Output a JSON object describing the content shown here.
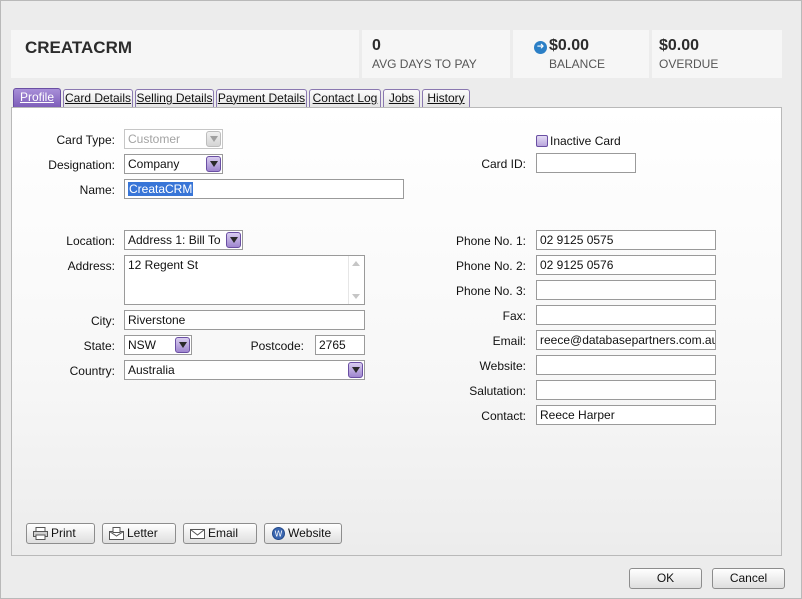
{
  "header": {
    "company": "CREATACRM",
    "avg_days_value": "0",
    "avg_days_label": "AVG DAYS TO PAY",
    "balance_value": "$0.00",
    "balance_label": "BALANCE",
    "overdue_value": "$0.00",
    "overdue_label": "OVERDUE"
  },
  "tabs": [
    "Profile",
    "Card Details",
    "Selling Details",
    "Payment Details",
    "Contact Log",
    "Jobs",
    "History"
  ],
  "form": {
    "card_type_label": "Card Type:",
    "card_type_value": "Customer",
    "designation_label": "Designation:",
    "designation_value": "Company",
    "name_label": "Name:",
    "name_value": "CreataCRM",
    "inactive_label": "Inactive Card",
    "card_id_label": "Card ID:",
    "card_id_value": "",
    "location_label": "Location:",
    "location_value": "Address 1: Bill To",
    "address_label": "Address:",
    "address_value": "12 Regent St",
    "city_label": "City:",
    "city_value": "Riverstone",
    "state_label": "State:",
    "state_value": "NSW",
    "postcode_label": "Postcode:",
    "postcode_value": "2765",
    "country_label": "Country:",
    "country_value": "Australia",
    "phone1_label": "Phone No. 1:",
    "phone1_value": "02 9125 0575",
    "phone2_label": "Phone No. 2:",
    "phone2_value": "02 9125 0576",
    "phone3_label": "Phone No. 3:",
    "phone3_value": "",
    "fax_label": "Fax:",
    "fax_value": "",
    "email_label": "Email:",
    "email_value": "reece@databasepartners.com.au",
    "website_label": "Website:",
    "website_value": "",
    "salutation_label": "Salutation:",
    "salutation_value": "",
    "contact_label": "Contact:",
    "contact_value": "Reece Harper"
  },
  "actions": {
    "print": "Print",
    "letter": "Letter",
    "email": "Email",
    "website": "Website"
  },
  "dialog": {
    "ok": "OK",
    "cancel": "Cancel"
  },
  "colors": {
    "accent": "#7b5bb8",
    "selection": "#3875d7",
    "balance_icon": "#2b7fc6"
  }
}
